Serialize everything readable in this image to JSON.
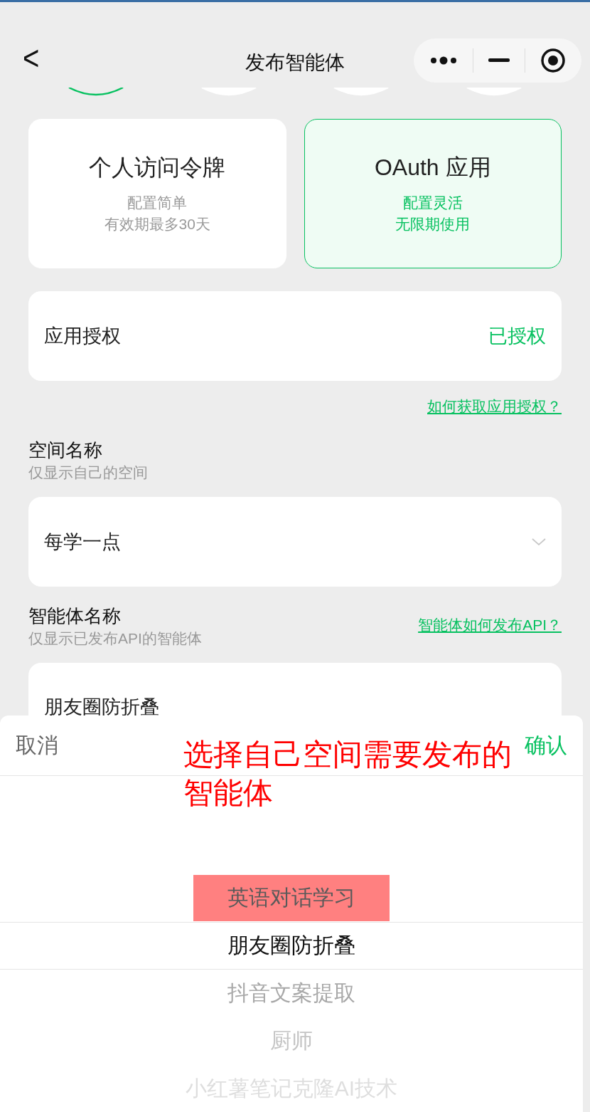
{
  "nav": {
    "title": "发布智能体",
    "back": "<"
  },
  "steps": [
    {
      "selected": true
    },
    {
      "selected": false
    },
    {
      "selected": false
    },
    {
      "selected": false
    }
  ],
  "token_types": [
    {
      "title": "个人访问令牌",
      "lines": [
        "配置简单",
        "有效期最多30天"
      ],
      "selected": false
    },
    {
      "title": "OAuth 应用",
      "lines": [
        "配置灵活",
        "无限期使用"
      ],
      "selected": true
    }
  ],
  "authorization": {
    "label": "应用授权",
    "status": "已授权",
    "help_link": "如何获取应用授权？"
  },
  "space": {
    "label": "空间名称",
    "hint": "仅显示自己的空间",
    "value": "每学一点"
  },
  "agent": {
    "label": "智能体名称",
    "hint": "仅显示已发布API的智能体",
    "help_link": "智能体如何发布API？",
    "value": "朋友圈防折叠"
  },
  "picker": {
    "cancel": "取消",
    "confirm": "确认",
    "options": [
      {
        "label": "英语对话学习",
        "selected": false,
        "highlighted": true
      },
      {
        "label": "朋友圈防折叠",
        "selected": true,
        "highlighted": false
      },
      {
        "label": "抖音文案提取",
        "selected": false,
        "highlighted": false
      },
      {
        "label": "厨师",
        "selected": false,
        "highlighted": false
      },
      {
        "label": "小红薯笔记克隆AI技术",
        "selected": false,
        "highlighted": false
      }
    ]
  },
  "annotation": {
    "text": "选择自己空间需要发布的智能体"
  }
}
